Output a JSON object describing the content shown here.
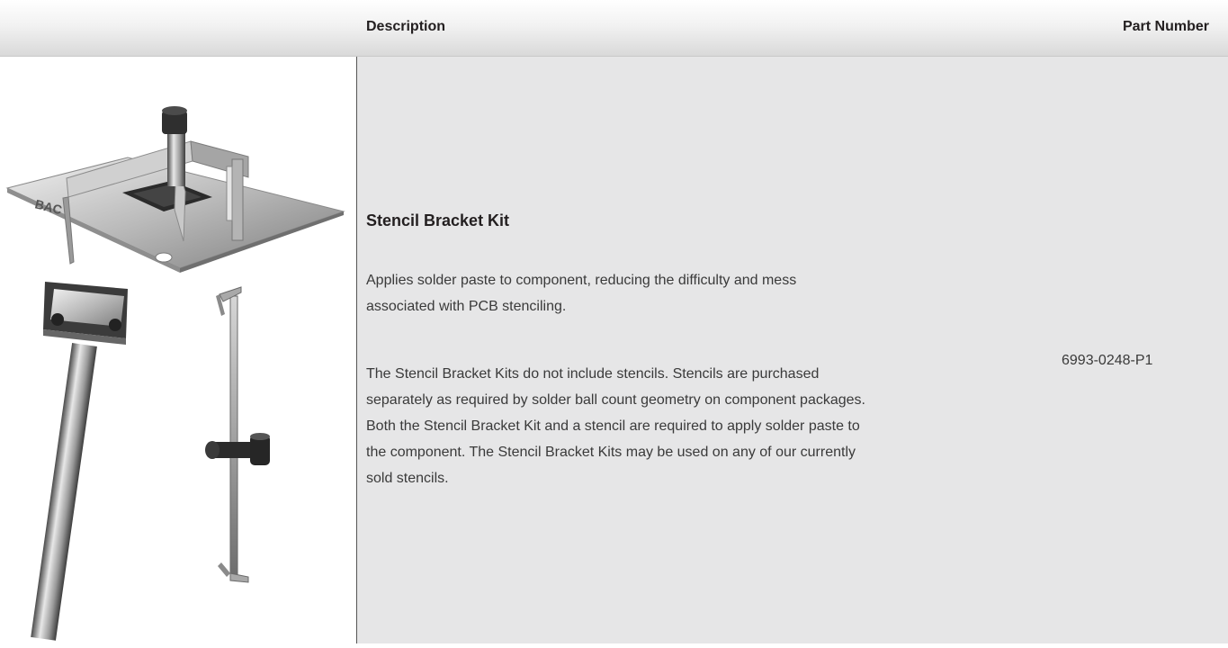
{
  "table": {
    "columns": {
      "description": "Description",
      "part_number": "Part Number"
    },
    "rows": [
      {
        "title": "Stencil Bracket Kit",
        "paragraphs": [
          [
            "Applies solder paste to component, reducing the difficulty and mess",
            "associated with PCB stenciling."
          ],
          [
            "The Stencil Bracket Kits do not include stencils. Stencils are purchased",
            "separately as required by solder ball count geometry on component packages.",
            "Both the Stencil Bracket Kit and a stencil are required to apply solder paste to",
            "the component. The Stencil Bracket Kits may be used on any of our currently",
            "sold stencils."
          ]
        ],
        "part_number": "6993-0248-P1",
        "image_icons": [
          "stencil-bracket-plate-icon",
          "squeegee-tool-icon",
          "bracket-clamp-icon"
        ]
      }
    ]
  },
  "colors": {
    "description_bg": "#e6e6e7",
    "header_gradient_end": "#d9d9d9",
    "text": "#231f20"
  }
}
